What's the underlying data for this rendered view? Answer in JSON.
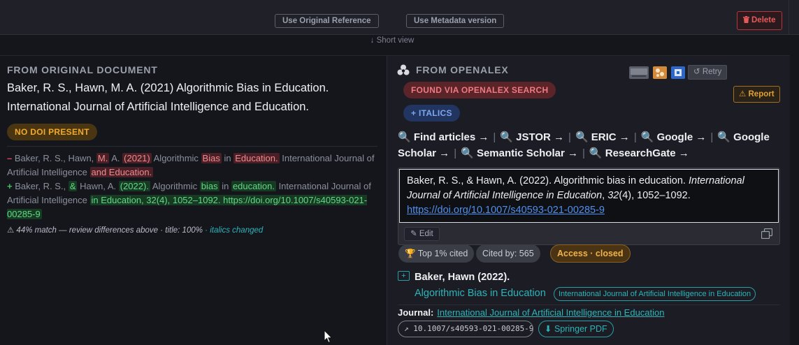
{
  "toolbar": {
    "use_original_label": "Use Original Reference",
    "use_metadata_label": "Use Metadata version",
    "delete_label": "Delete",
    "short_view_label": "↓ Short view"
  },
  "original": {
    "section_title": "FROM ORIGINAL DOCUMENT",
    "reference_line1": "Baker, R. S., Hawn, M. A. (2021) Algorithmic Bias in Education.",
    "reference_line2": "International Journal of Artificial Intelligence and Education.",
    "no_doi_label": "NO DOI PRESENT"
  },
  "diff": {
    "minus_sign": "–",
    "minus_segments": [
      {
        "t": "Baker, R. S., Hawn, ",
        "k": "plain"
      },
      {
        "t": "M.",
        "k": "del"
      },
      {
        "t": " A. ",
        "k": "plain"
      },
      {
        "t": "(2021)",
        "k": "del"
      },
      {
        "t": " Algorithmic ",
        "k": "plain"
      },
      {
        "t": "Bias",
        "k": "del"
      },
      {
        "t": " in ",
        "k": "plain"
      },
      {
        "t": "Education.",
        "k": "del"
      },
      {
        "t": " International Journal of Artificial Intelligence ",
        "k": "plain"
      },
      {
        "t": "and Education.",
        "k": "del"
      }
    ],
    "plus_sign": "+",
    "plus_segments": [
      {
        "t": "Baker, R. S., ",
        "k": "plain"
      },
      {
        "t": "&",
        "k": "ins"
      },
      {
        "t": " Hawn, A. ",
        "k": "plain"
      },
      {
        "t": "(2022).",
        "k": "ins"
      },
      {
        "t": " Algorithmic ",
        "k": "plain"
      },
      {
        "t": "bias",
        "k": "ins"
      },
      {
        "t": " in ",
        "k": "plain"
      },
      {
        "t": "education.",
        "k": "ins"
      },
      {
        "t": " International Journal of Artificial Intelligence ",
        "k": "plain"
      },
      {
        "t": "in Education, 32(4), 1052–1092. https://doi.org/10.1007/s40593-021-00285-9",
        "k": "ins"
      }
    ],
    "match_note": "⚠ 44% match — review differences above · title: 100%",
    "italics_note": " · italics changed"
  },
  "openalex": {
    "section_title": "FROM OPENALEX",
    "retry_label": "↺ Retry",
    "report_label": "⚠ Report",
    "found_label": "FOUND VIA OPENALEX SEARCH",
    "italics_label": "+ ITALICS",
    "search_links": [
      "🔍 Find articles →",
      "🔍 JSTOR →",
      "🔍 ERIC →",
      "🔍 Google →",
      "🔍 Google Scholar →",
      "🔍 Semantic Scholar →",
      "🔍 ResearchGate →"
    ],
    "link_separator": "|",
    "citation_plain1": "Baker, R. S., & Hawn, A. (2022). Algorithmic bias in education. ",
    "citation_italic": "International Journal of Artificial Intelligence in Education",
    "citation_plain2": ", ",
    "citation_volume": "32",
    "citation_plain3": "(4), 1052–1092.",
    "citation_doi_url": "https://doi.org/10.1007/s40593-021-00285-9",
    "edit_label": "✎ Edit",
    "top_cited_label": "🏆 Top 1% cited",
    "cited_by_label": "Cited by: 565",
    "access_label": "Access · closed",
    "expand_label": "+",
    "result_author": "Baker, Hawn (2022).",
    "result_title": "Algorithmic Bias in Education",
    "result_journal": "International Journal of Artificial Intelligence in Education",
    "journal_prefix": "Journal:",
    "journal_link": "International Journal of Artificial Intelligence in Education",
    "doi_pill": "↗ 10.1007/s40593-021-00285-9",
    "pdf_label": "⬇ Springer PDF"
  },
  "colors": {
    "accent_teal": "#2db4b9",
    "delete_red": "#e45a5a",
    "warn_orange": "#f0a92a",
    "link_blue": "#4f8ff0"
  },
  "icons": [
    "trash-icon",
    "openalex-icon",
    "crossref-icon",
    "semantic-scholar-icon",
    "google-icon",
    "copy-icon",
    "mouse-cursor-icon"
  ]
}
